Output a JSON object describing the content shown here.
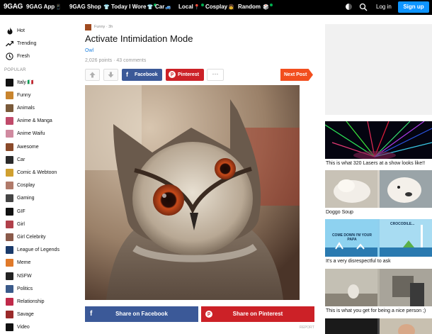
{
  "header": {
    "logo": "9GAG",
    "nav": [
      {
        "label": "9GAG App",
        "emoji": "📱"
      },
      {
        "label": "9GAG Shop",
        "emoji": "👕"
      },
      {
        "label": "Today I Wore",
        "emoji": "👕"
      },
      {
        "label": "Car",
        "emoji": "🚙"
      },
      {
        "label": "Local",
        "emoji": "📍"
      },
      {
        "label": "Cosplay",
        "emoji": "👧"
      },
      {
        "label": "Random",
        "emoji": "🎲"
      }
    ],
    "login": "Log in",
    "signup": "Sign up"
  },
  "sidebar": {
    "main": [
      {
        "label": "Hot",
        "icon": "flame-icon"
      },
      {
        "label": "Trending",
        "icon": "trending-icon"
      },
      {
        "label": "Fresh",
        "icon": "clock-icon"
      }
    ],
    "popular_label": "POPULAR",
    "categories": [
      {
        "label": "Italy 🇮🇹",
        "color": "#111111"
      },
      {
        "label": "Funny",
        "color": "#c8842e"
      },
      {
        "label": "Animals",
        "color": "#7a5a3a"
      },
      {
        "label": "Anime & Manga",
        "color": "#c04a6a"
      },
      {
        "label": "Anime Waifu",
        "color": "#d08aa0"
      },
      {
        "label": "Awesome",
        "color": "#8a4a2a"
      },
      {
        "label": "Car",
        "color": "#2a2a2a"
      },
      {
        "label": "Comic & Webtoon",
        "color": "#d0a030"
      },
      {
        "label": "Cosplay",
        "color": "#b07a6a"
      },
      {
        "label": "Gaming",
        "color": "#444444"
      },
      {
        "label": "GIF",
        "color": "#111111"
      },
      {
        "label": "Girl",
        "color": "#b0404a"
      },
      {
        "label": "Girl Celebrity",
        "color": "#8a5a4a"
      },
      {
        "label": "League of Legends",
        "color": "#1a3a6a"
      },
      {
        "label": "Meme",
        "color": "#e07a2a"
      },
      {
        "label": "NSFW",
        "color": "#222222"
      },
      {
        "label": "Politics",
        "color": "#3a5a8a"
      },
      {
        "label": "Relationship",
        "color": "#c02a4a"
      },
      {
        "label": "Savage",
        "color": "#9a2a2a"
      },
      {
        "label": "Video",
        "color": "#111111"
      }
    ]
  },
  "post": {
    "meta": "Funny · 3h",
    "title": "Activate Intimidation Mode",
    "tag": "Owl",
    "stats": "2,026 points · 43 comments",
    "facebook": "Facebook",
    "pinterest": "Pinterest",
    "more": "···",
    "next": "Next Post",
    "share_facebook": "Share on Facebook",
    "share_pinterest": "Share on Pinterest",
    "report": "REPORT"
  },
  "right": [
    {
      "caption": "This is what 320 Lasers at a show looks like!!"
    },
    {
      "caption": "Doggo Soup"
    },
    {
      "caption": "It's a very disrespectful to ask",
      "panel_text_1": "COME DOWN I'M YOUR PAPA",
      "panel_text_2": "CROCODILE..."
    },
    {
      "caption": "This is what you get for being a nice person ;)"
    }
  ]
}
